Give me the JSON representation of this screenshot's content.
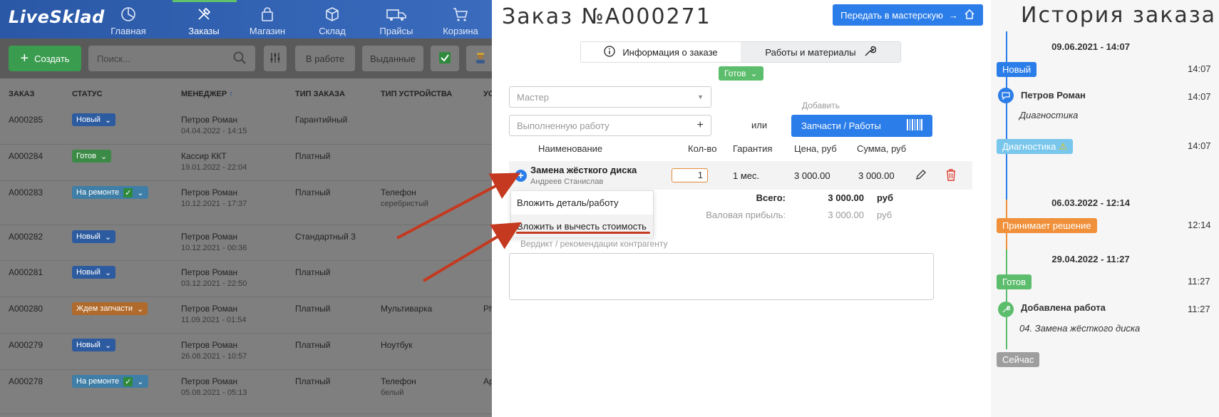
{
  "app": {
    "logo": "LiveSklad"
  },
  "nav": [
    {
      "label": "Главная",
      "icon": "chart-pie-icon"
    },
    {
      "label": "Заказы",
      "icon": "tools-icon",
      "active": true
    },
    {
      "label": "Магазин",
      "icon": "bag-icon"
    },
    {
      "label": "Склад",
      "icon": "box-icon"
    },
    {
      "label": "Прайсы",
      "icon": "truck-icon"
    },
    {
      "label": "Корзина",
      "icon": "cart-icon"
    }
  ],
  "toolbar": {
    "create_label": "Создать",
    "search_placeholder": "Поиск...",
    "filter_in_work": "В работе",
    "filter_issued": "Выданные"
  },
  "table": {
    "headers": [
      "ЗАКАЗ",
      "СТАТУС",
      "МЕНЕДЖЕР",
      "ТИП ЗАКАЗА",
      "ТИП УСТРОЙСТВА",
      "УС"
    ],
    "rows": [
      {
        "order": "A000285",
        "status": "Новый",
        "manager": "Петров Роман",
        "date": "04.04.2022 - 14:15",
        "type": "Гарантийный",
        "device": "",
        "device_sub": "",
        "extra": ""
      },
      {
        "order": "A000284",
        "status": "Готов",
        "manager": "Кассир ККТ",
        "date": "19.01.2022 - 22:04",
        "type": "Платный",
        "device": "",
        "device_sub": "",
        "extra": ""
      },
      {
        "order": "A000283",
        "status": "На ремонте",
        "manager": "Петров Роман",
        "date": "10.12.2021 - 17:37",
        "type": "Платный",
        "device": "Телефон",
        "device_sub": "серебристый",
        "extra": ""
      },
      {
        "order": "A000282",
        "status": "Новый",
        "manager": "Петров Роман",
        "date": "10.12.2021 - 00:36",
        "type": "Стандартный 3",
        "device": "",
        "device_sub": "",
        "extra": ""
      },
      {
        "order": "A000281",
        "status": "Новый",
        "manager": "Петров Роман",
        "date": "03.12.2021 - 22:50",
        "type": "Платный",
        "device": "",
        "device_sub": "",
        "extra": ""
      },
      {
        "order": "A000280",
        "status": "Ждем запчасти",
        "manager": "Петров Роман",
        "date": "11.09.2021 - 01:54",
        "type": "Платный",
        "device": "Мультиварка",
        "device_sub": "",
        "extra": "Ph"
      },
      {
        "order": "A000279",
        "status": "Новый",
        "manager": "Петров Роман",
        "date": "26.08.2021 - 10:57",
        "type": "Платный",
        "device": "Ноутбук",
        "device_sub": "",
        "extra": ""
      },
      {
        "order": "A000278",
        "status": "На ремонте",
        "manager": "Петров Роман",
        "date": "05.08.2021 - 05:13",
        "type": "Платный",
        "device": "Телефон",
        "device_sub": "белый",
        "extra": "Ap"
      }
    ]
  },
  "order": {
    "title": "Заказ №A000271",
    "transfer_label": "Передать в мастерскую",
    "tab_info": "Информация о заказе",
    "tab_works": "Работы и материалы",
    "status": "Готов",
    "master_placeholder": "Мастер",
    "work_placeholder": "Выполненную работу",
    "or_label": "или",
    "add_label": "Добавить",
    "parts_button": "Запчасти / Работы",
    "columns": {
      "name": "Наименование",
      "qty": "Кол-во",
      "warranty": "Гарантия",
      "price": "Цена, руб",
      "sum": "Сумма, руб"
    },
    "item": {
      "name": "Замена жёсткого диска",
      "master": "Андреев Станислав",
      "qty": "1",
      "warranty": "1 мес.",
      "price": "3 000.00",
      "sum": "3 000.00"
    },
    "totals": {
      "total_label": "Всего:",
      "total_value": "3 000.00",
      "total_unit": "руб",
      "profit_label": "Валовая прибыль:",
      "profit_value": "3 000.00",
      "profit_unit": "руб"
    },
    "menu": [
      "Вложить деталь/работу",
      "Вложить и вычесть стоимость"
    ],
    "verdict_label": "Вердикт / рекомендации контрагенту"
  },
  "history": {
    "title": "История заказа",
    "groups": [
      {
        "date": "09.06.2021 - 14:07"
      },
      {
        "date": "06.03.2022 - 12:14"
      },
      {
        "date": "29.04.2022 - 11:27"
      }
    ],
    "entries": {
      "new_badge": "Новый",
      "new_time": "14:07",
      "comment_name": "Петров Роман",
      "comment_time": "14:07",
      "comment_note": "Диагностика",
      "diag_badge": "Диагностика",
      "diag_time": "14:07",
      "decision_badge": "Принимает решение",
      "decision_time": "12:14",
      "ready_badge": "Готов",
      "ready_time": "11:27",
      "work_name": "Добавлена работа",
      "work_time": "11:27",
      "work_note": "04. Замена жёсткого диска",
      "now_badge": "Сейчас"
    }
  },
  "colors": {
    "accent": "#2b7de9",
    "success": "#5cbd6c",
    "warning": "#f0903a",
    "info": "#78c6ec",
    "arrow": "#c4391f"
  }
}
